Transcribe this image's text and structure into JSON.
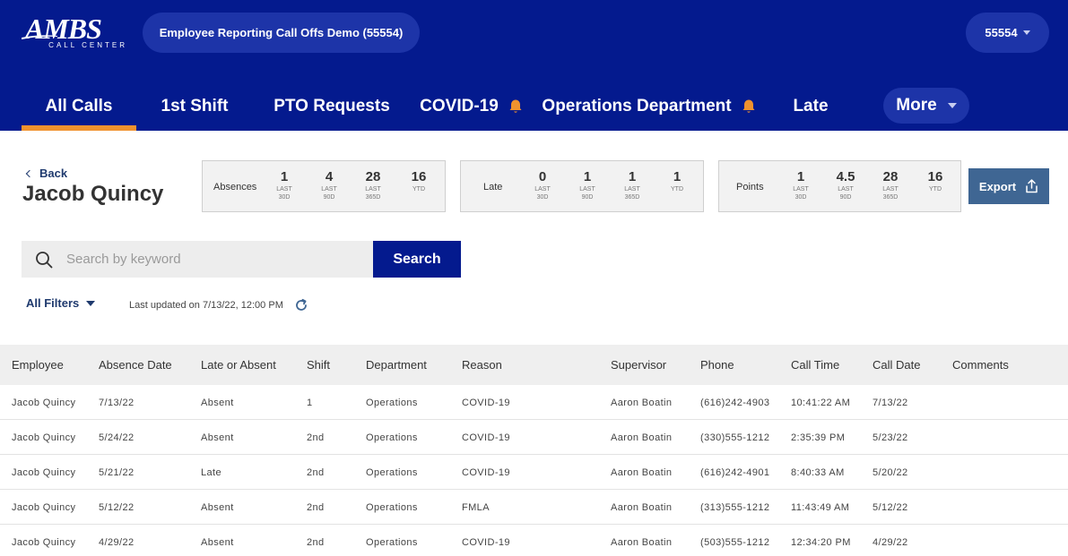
{
  "header": {
    "logo_main": "AMBS",
    "logo_sub": "CALL CENTER",
    "app_title": "Employee Reporting Call Offs Demo (55554)",
    "account": "55554"
  },
  "nav": {
    "tabs": [
      {
        "label": "All Calls",
        "active": true
      },
      {
        "label": "1st Shift"
      },
      {
        "label": "PTO Requests"
      },
      {
        "label": "COVID-19",
        "icon": "bell-icon"
      },
      {
        "label": "Operations Department",
        "icon": "bell-icon"
      },
      {
        "label": "Late"
      }
    ],
    "more_label": "More"
  },
  "colors": {
    "header_bg": "#041a8e",
    "active_tab_underline": "#f0922e",
    "bell": "#f0922e",
    "export_bg": "#3f6693",
    "search_button_bg": "#041a8e"
  },
  "profile": {
    "back_label": "Back",
    "name": "Jacob Quincy"
  },
  "stats": {
    "absences": {
      "label": "Absences",
      "items": [
        {
          "value": "1",
          "sub1": "LAST",
          "sub2": "30D"
        },
        {
          "value": "4",
          "sub1": "LAST",
          "sub2": "90D"
        },
        {
          "value": "28",
          "sub1": "LAST",
          "sub2": "365D"
        },
        {
          "value": "16",
          "sub1": "YTD",
          "sub2": ""
        }
      ]
    },
    "late": {
      "label": "Late",
      "items": [
        {
          "value": "0",
          "sub1": "LAST",
          "sub2": "30D"
        },
        {
          "value": "1",
          "sub1": "LAST",
          "sub2": "90D"
        },
        {
          "value": "1",
          "sub1": "LAST",
          "sub2": "365D"
        },
        {
          "value": "1",
          "sub1": "YTD",
          "sub2": ""
        }
      ]
    },
    "points": {
      "label": "Points",
      "items": [
        {
          "value": "1",
          "sub1": "LAST",
          "sub2": "30D"
        },
        {
          "value": "4.5",
          "sub1": "LAST",
          "sub2": "90D"
        },
        {
          "value": "28",
          "sub1": "LAST",
          "sub2": "365D"
        },
        {
          "value": "16",
          "sub1": "YTD",
          "sub2": ""
        }
      ]
    }
  },
  "export_label": "Export",
  "search": {
    "placeholder": "Search by keyword",
    "value": "",
    "button_label": "Search"
  },
  "filters": {
    "label": "All Filters",
    "last_updated": "Last updated on 7/13/22, 12:00 PM"
  },
  "table": {
    "columns": [
      "Employee",
      "Absence Date",
      "Late or Absent",
      "Shift",
      "Department",
      "Reason",
      "Supervisor",
      "Phone",
      "Call Time",
      "Call Date",
      "Comments"
    ],
    "rows": [
      [
        "Jacob Quincy",
        "7/13/22",
        "Absent",
        "1",
        "Operations",
        "COVID-19",
        "Aaron Boatin",
        "(616)242-4903",
        "10:41:22 AM",
        "7/13/22",
        ""
      ],
      [
        "Jacob Quincy",
        "5/24/22",
        "Absent",
        "2nd",
        "Operations",
        "COVID-19",
        "Aaron Boatin",
        "(330)555-1212",
        "2:35:39 PM",
        "5/23/22",
        ""
      ],
      [
        "Jacob Quincy",
        "5/21/22",
        "Late",
        "2nd",
        "Operations",
        "COVID-19",
        "Aaron Boatin",
        "(616)242-4901",
        "8:40:33 AM",
        "5/20/22",
        ""
      ],
      [
        "Jacob Quincy",
        "5/12/22",
        "Absent",
        "2nd",
        "Operations",
        "FMLA",
        "Aaron Boatin",
        "(313)555-1212",
        "11:43:49 AM",
        "5/12/22",
        ""
      ],
      [
        "Jacob Quincy",
        "4/29/22",
        "Absent",
        "2nd",
        "Operations",
        "COVID-19",
        "Aaron Boatin",
        "(503)555-1212",
        "12:34:20 PM",
        "4/29/22",
        ""
      ]
    ]
  }
}
